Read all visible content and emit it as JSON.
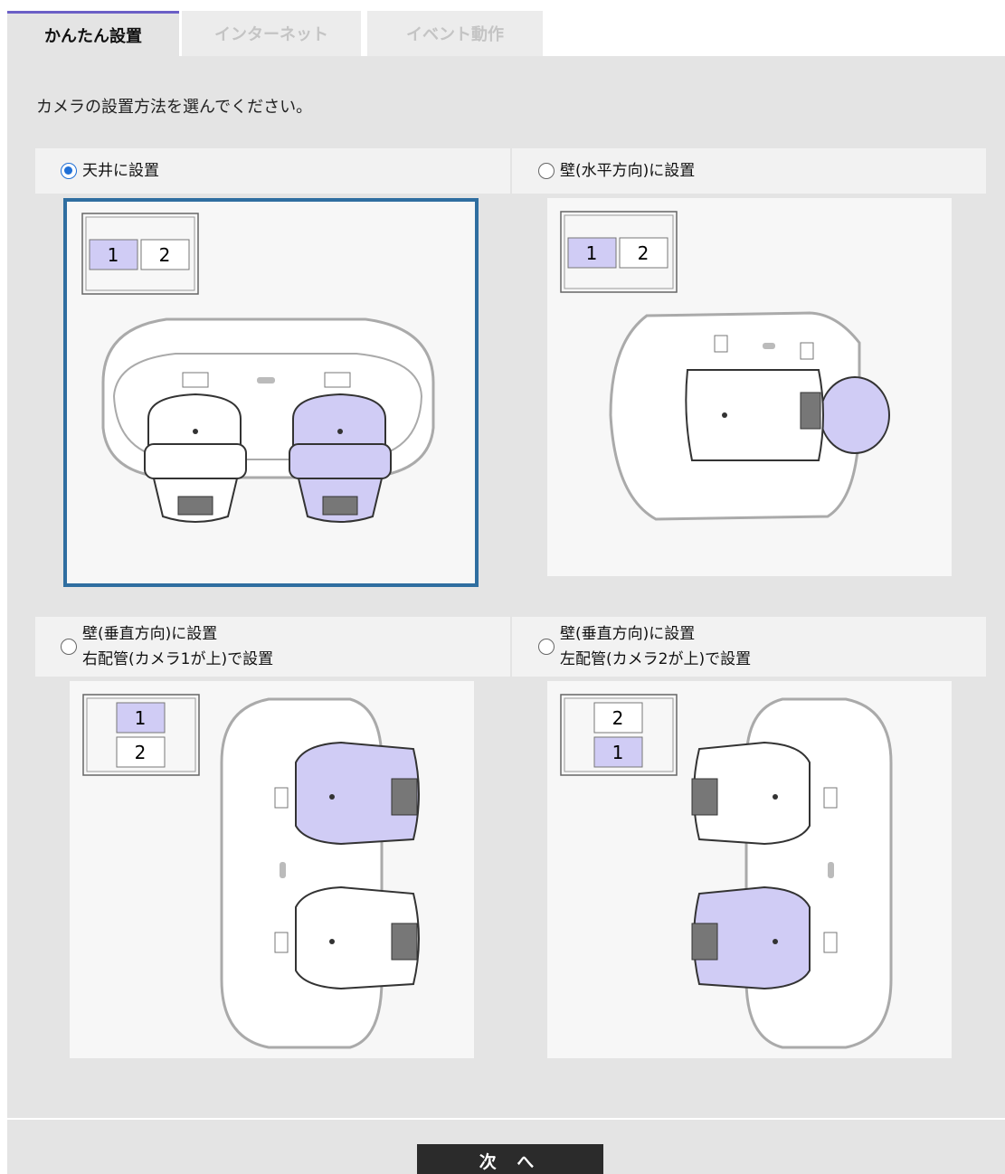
{
  "tabs": [
    {
      "label": "かんたん設置",
      "active": true
    },
    {
      "label": "インターネット",
      "active": false
    },
    {
      "label": "イベント動作",
      "active": false
    }
  ],
  "instruction": "カメラの設置方法を選んでください。",
  "options": [
    {
      "label_line1": "天井に設置",
      "label_line2": "",
      "selected": true,
      "camera_order": [
        "1",
        "2"
      ]
    },
    {
      "label_line1": "壁(水平方向)に設置",
      "label_line2": "",
      "selected": false,
      "camera_order": [
        "1",
        "2"
      ]
    },
    {
      "label_line1": "壁(垂直方向)に設置",
      "label_line2": "右配管(カメラ1が上)で設置",
      "selected": false,
      "camera_order": [
        "1",
        "2"
      ]
    },
    {
      "label_line1": "壁(垂直方向)に設置",
      "label_line2": "左配管(カメラ2が上)で設置",
      "selected": false,
      "camera_order": [
        "2",
        "1"
      ]
    }
  ],
  "next_button": "次 へ",
  "colors": {
    "accent_tab": "#6b5fc7",
    "selected_border": "#2f6ea0",
    "camera_highlight": "#d0ccf5",
    "radio": "#1f6fd6"
  }
}
